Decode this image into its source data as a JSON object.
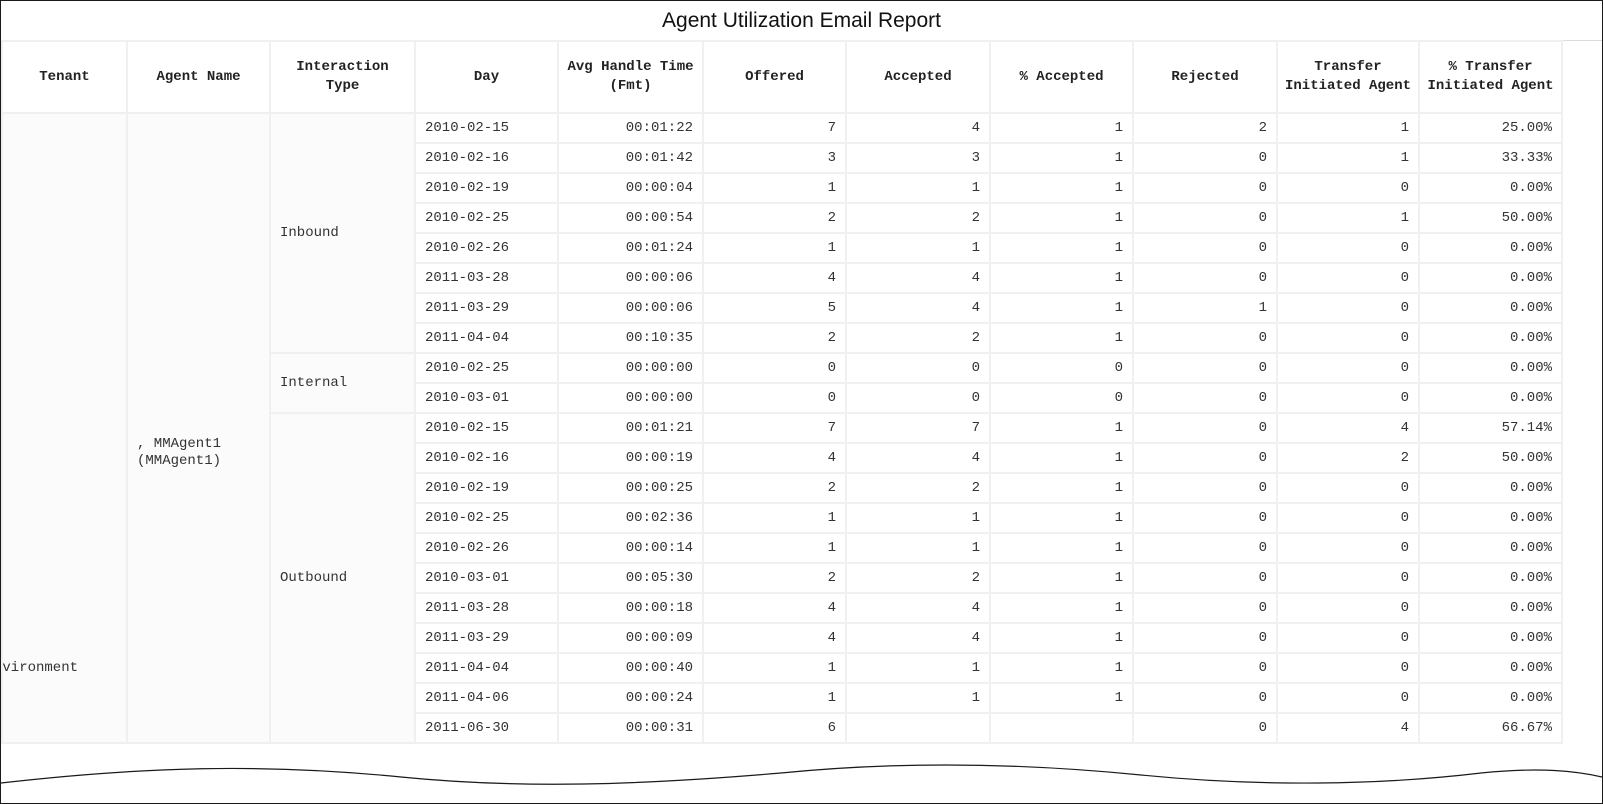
{
  "report": {
    "title": "Agent Utilization Email Report",
    "columns": [
      "Tenant",
      "Agent Name",
      "Interaction Type",
      "Day",
      "Avg Handle Time (Fmt)",
      "Offered",
      "Accepted",
      "% Accepted",
      "Rejected",
      "Transfer Initiated Agent",
      "% Transfer Initiated Agent"
    ],
    "tenant": "nvironment",
    "agent": ", MMAgent1 (MMAgent1)",
    "groups": [
      {
        "type": "Inbound",
        "rows": [
          [
            "2010-02-15",
            "00:01:22",
            "7",
            "4",
            "1",
            "2",
            "1",
            "25.00%"
          ],
          [
            "2010-02-16",
            "00:01:42",
            "3",
            "3",
            "1",
            "0",
            "1",
            "33.33%"
          ],
          [
            "2010-02-19",
            "00:00:04",
            "1",
            "1",
            "1",
            "0",
            "0",
            "0.00%"
          ],
          [
            "2010-02-25",
            "00:00:54",
            "2",
            "2",
            "1",
            "0",
            "1",
            "50.00%"
          ],
          [
            "2010-02-26",
            "00:01:24",
            "1",
            "1",
            "1",
            "0",
            "0",
            "0.00%"
          ],
          [
            "2011-03-28",
            "00:00:06",
            "4",
            "4",
            "1",
            "0",
            "0",
            "0.00%"
          ],
          [
            "2011-03-29",
            "00:00:06",
            "5",
            "4",
            "1",
            "1",
            "0",
            "0.00%"
          ],
          [
            "2011-04-04",
            "00:10:35",
            "2",
            "2",
            "1",
            "0",
            "0",
            "0.00%"
          ]
        ]
      },
      {
        "type": "Internal",
        "rows": [
          [
            "2010-02-25",
            "00:00:00",
            "0",
            "0",
            "0",
            "0",
            "0",
            "0.00%"
          ],
          [
            "2010-03-01",
            "00:00:00",
            "0",
            "0",
            "0",
            "0",
            "0",
            "0.00%"
          ]
        ]
      },
      {
        "type": "Outbound",
        "rows": [
          [
            "2010-02-15",
            "00:01:21",
            "7",
            "7",
            "1",
            "0",
            "4",
            "57.14%"
          ],
          [
            "2010-02-16",
            "00:00:19",
            "4",
            "4",
            "1",
            "0",
            "2",
            "50.00%"
          ],
          [
            "2010-02-19",
            "00:00:25",
            "2",
            "2",
            "1",
            "0",
            "0",
            "0.00%"
          ],
          [
            "2010-02-25",
            "00:02:36",
            "1",
            "1",
            "1",
            "0",
            "0",
            "0.00%"
          ],
          [
            "2010-02-26",
            "00:00:14",
            "1",
            "1",
            "1",
            "0",
            "0",
            "0.00%"
          ],
          [
            "2010-03-01",
            "00:05:30",
            "2",
            "2",
            "1",
            "0",
            "0",
            "0.00%"
          ],
          [
            "2011-03-28",
            "00:00:18",
            "4",
            "4",
            "1",
            "0",
            "0",
            "0.00%"
          ],
          [
            "2011-03-29",
            "00:00:09",
            "4",
            "4",
            "1",
            "0",
            "0",
            "0.00%"
          ],
          [
            "2011-04-04",
            "00:00:40",
            "1",
            "1",
            "1",
            "0",
            "0",
            "0.00%"
          ],
          [
            "2011-04-06",
            "00:00:24",
            "1",
            "1",
            "1",
            "0",
            "0",
            "0.00%"
          ],
          [
            "2011-06-30",
            "00:00:31",
            "6",
            "",
            "",
            "0",
            "4",
            "66.67%"
          ]
        ]
      }
    ]
  }
}
